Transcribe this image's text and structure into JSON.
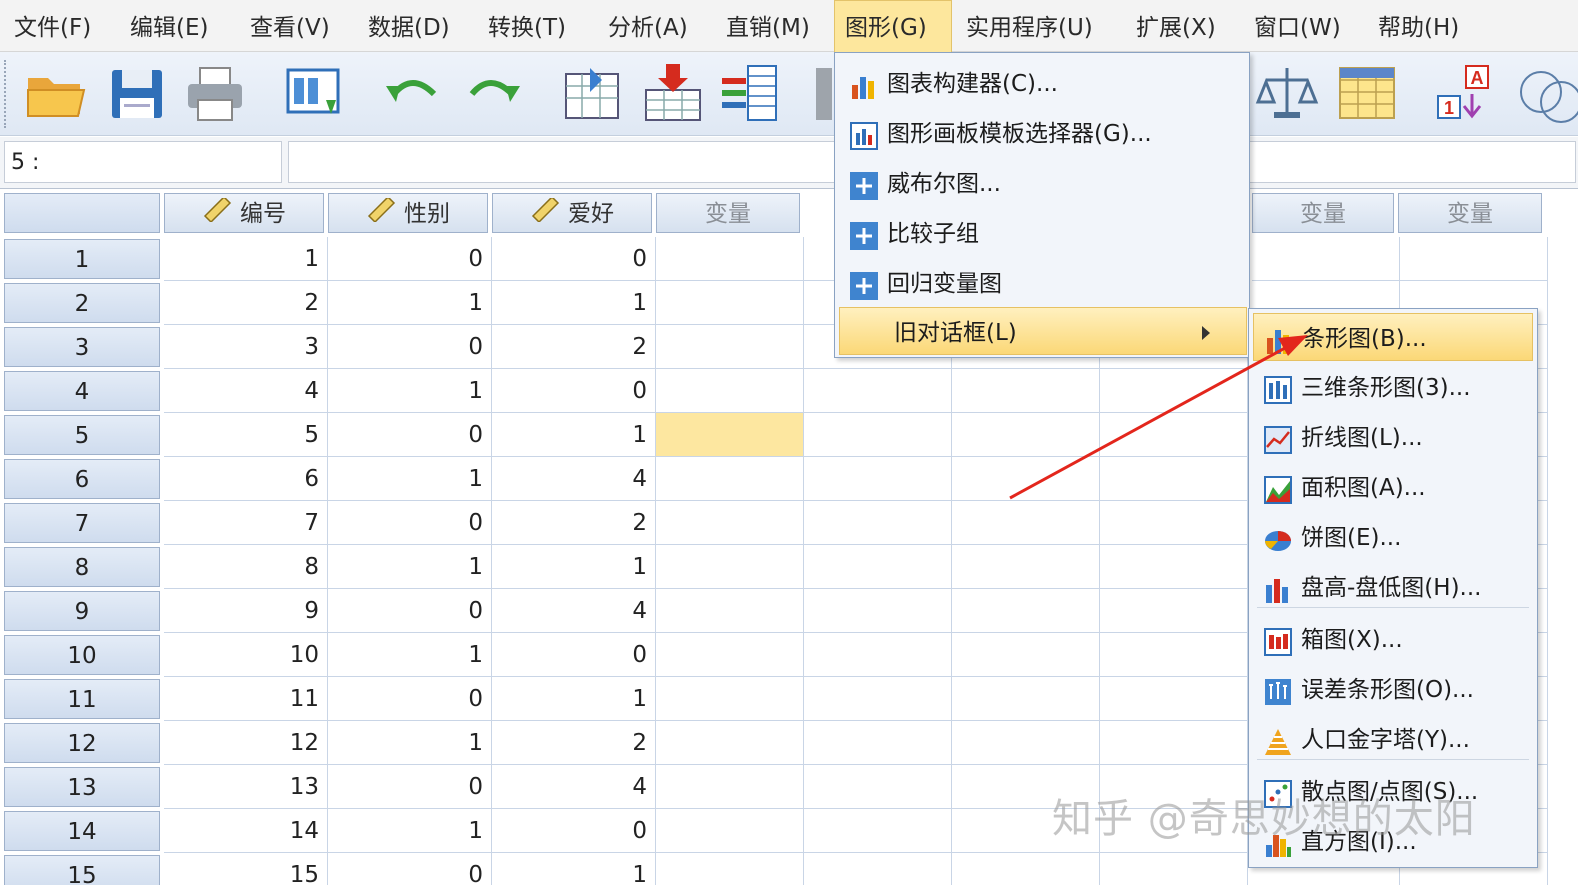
{
  "menubar": {
    "items": [
      {
        "label": "文件(F)"
      },
      {
        "label": "编辑(E)"
      },
      {
        "label": "查看(V)"
      },
      {
        "label": "数据(D)"
      },
      {
        "label": "转换(T)"
      },
      {
        "label": "分析(A)"
      },
      {
        "label": "直销(M)"
      },
      {
        "label": "图形(G)"
      },
      {
        "label": "实用程序(U)"
      },
      {
        "label": "扩展(X)"
      },
      {
        "label": "窗口(W)"
      },
      {
        "label": "帮助(H)"
      }
    ],
    "active": "图形(G)"
  },
  "toolbar": {
    "icons": [
      "open-folder-icon",
      "save-icon",
      "print-icon",
      "dialog-recall-icon",
      "undo-icon",
      "redo-icon",
      "goto-case-icon",
      "goto-variable-icon",
      "variables-icon",
      "weight-cases-icon",
      "value-labels-icon",
      "use-sets-icon"
    ]
  },
  "cellbar": {
    "ref": "5 :",
    "value": ""
  },
  "grid": {
    "columns": [
      {
        "label": "编号",
        "type": "scale"
      },
      {
        "label": "性别",
        "type": "scale"
      },
      {
        "label": "爱好",
        "type": "scale"
      },
      {
        "label": "变量",
        "type": "empty"
      },
      {
        "label": "变量",
        "type": "empty"
      },
      {
        "label": "变量",
        "type": "empty"
      }
    ],
    "rows": [
      {
        "n": "1",
        "c": [
          "1",
          "0",
          "0"
        ]
      },
      {
        "n": "2",
        "c": [
          "2",
          "1",
          "1"
        ]
      },
      {
        "n": "3",
        "c": [
          "3",
          "0",
          "2"
        ]
      },
      {
        "n": "4",
        "c": [
          "4",
          "1",
          "0"
        ]
      },
      {
        "n": "5",
        "c": [
          "5",
          "0",
          "1"
        ]
      },
      {
        "n": "6",
        "c": [
          "6",
          "1",
          "4"
        ]
      },
      {
        "n": "7",
        "c": [
          "7",
          "0",
          "2"
        ]
      },
      {
        "n": "8",
        "c": [
          "8",
          "1",
          "1"
        ]
      },
      {
        "n": "9",
        "c": [
          "9",
          "0",
          "4"
        ]
      },
      {
        "n": "10",
        "c": [
          "10",
          "1",
          "0"
        ]
      },
      {
        "n": "11",
        "c": [
          "11",
          "0",
          "1"
        ]
      },
      {
        "n": "12",
        "c": [
          "12",
          "1",
          "2"
        ]
      },
      {
        "n": "13",
        "c": [
          "13",
          "0",
          "4"
        ]
      },
      {
        "n": "14",
        "c": [
          "14",
          "1",
          "0"
        ]
      },
      {
        "n": "15",
        "c": [
          "15",
          "0",
          "1"
        ]
      }
    ],
    "selected_row": "5"
  },
  "graphs_menu": {
    "items": [
      {
        "label": "图表构建器(C)...",
        "icon": "chart-builder-icon"
      },
      {
        "label": "图形画板模板选择器(G)...",
        "icon": "template-chooser-icon"
      },
      {
        "label": "威布尔图...",
        "icon": "plus-icon"
      },
      {
        "label": "比较子组",
        "icon": "plus-icon"
      },
      {
        "label": "回归变量图",
        "icon": "plus-icon"
      },
      {
        "label": "旧对话框(L)",
        "icon": "",
        "submenu": true
      }
    ]
  },
  "legacy_submenu": {
    "items": [
      {
        "label": "条形图(B)...",
        "icon": "bar-chart-icon"
      },
      {
        "label": "三维条形图(3)...",
        "icon": "3d-bar-chart-icon"
      },
      {
        "label": "折线图(L)...",
        "icon": "line-chart-icon"
      },
      {
        "label": "面积图(A)...",
        "icon": "area-chart-icon"
      },
      {
        "label": "饼图(E)...",
        "icon": "pie-chart-icon"
      },
      {
        "label": "盘高-盘低图(H)...",
        "icon": "high-low-chart-icon"
      },
      {
        "label": "箱图(X)...",
        "icon": "boxplot-icon"
      },
      {
        "label": "误差条形图(O)...",
        "icon": "error-bar-icon"
      },
      {
        "label": "人口金字塔(Y)...",
        "icon": "population-pyramid-icon"
      },
      {
        "label": "散点图/点图(S)...",
        "icon": "scatter-icon"
      },
      {
        "label": "直方图(I)...",
        "icon": "histogram-icon"
      }
    ]
  },
  "watermark": "知乎 @奇思妙想的太阳"
}
